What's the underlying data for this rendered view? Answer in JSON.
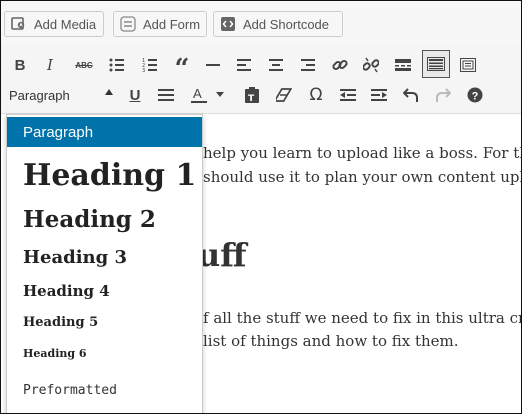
{
  "media_buttons": {
    "add_media": "Add Media",
    "add_form": "Add Form",
    "add_shortcode": "Add Shortcode"
  },
  "toolbar": {
    "row1": [
      "bold-icon",
      "italic-icon",
      "strikethrough-icon",
      "bullet-list-icon",
      "numbered-list-icon",
      "blockquote-icon",
      "horizontal-line-icon",
      "align-left-icon",
      "align-center-icon",
      "align-right-icon",
      "link-icon",
      "unlink-icon",
      "read-more-icon",
      "toolbar-toggle-icon",
      "distraction-free-icon"
    ],
    "row2": [
      "underline-icon",
      "justify-icon",
      "text-color-icon",
      "text-color-caret-icon",
      "paste-as-text-icon",
      "clear-formatting-icon",
      "special-character-icon",
      "outdent-icon",
      "indent-icon",
      "undo-icon",
      "redo-icon",
      "help-icon"
    ],
    "format_value": "Paragraph"
  },
  "editor": {
    "line1": "help you learn to upload like a boss.  For the p",
    "line2": "should use it to plan your own content upload",
    "heading": "uff",
    "line3": "f all the stuff we need to fix in this ultra crapp",
    "line4": "list of things and how to fix them."
  },
  "format_menu": {
    "items": [
      {
        "label": "Paragraph"
      },
      {
        "label": "Heading 1"
      },
      {
        "label": "Heading 2"
      },
      {
        "label": "Heading 3"
      },
      {
        "label": "Heading 4"
      },
      {
        "label": "Heading 5"
      },
      {
        "label": "Heading 6"
      },
      {
        "label": "Preformatted"
      }
    ]
  },
  "colors": {
    "accent": "#0073aa",
    "toolbar_bg": "#f5f5f5",
    "text": "#444444"
  }
}
